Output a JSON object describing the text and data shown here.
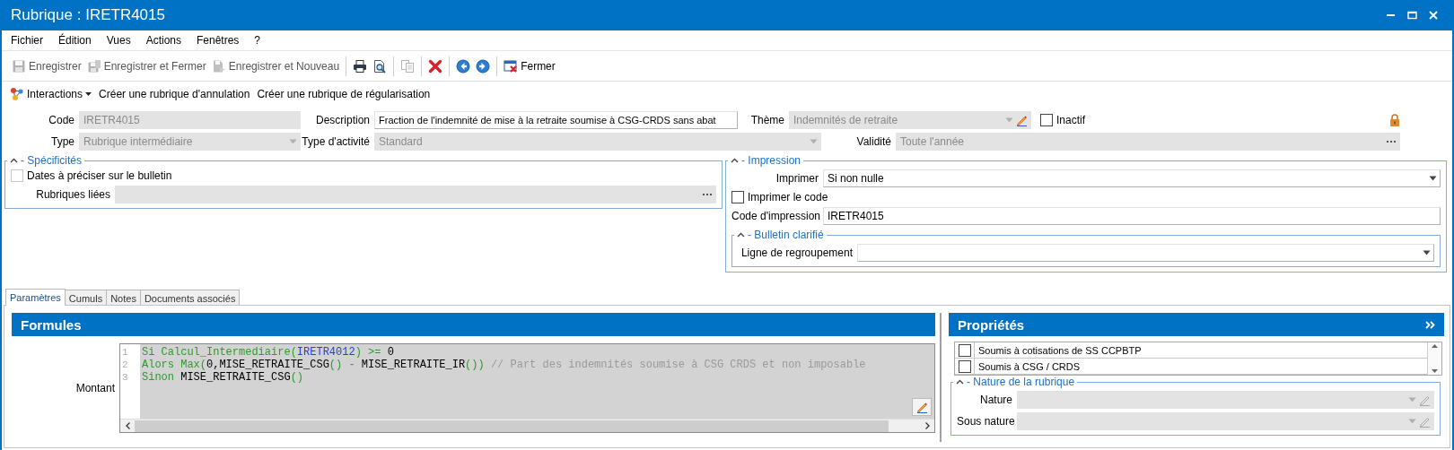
{
  "window": {
    "title": "Rubrique : IRETR4015"
  },
  "menu": [
    "Fichier",
    "Édition",
    "Vues",
    "Actions",
    "Fenêtres",
    "?"
  ],
  "toolbar": [
    {
      "kind": "text-button",
      "label": "Enregistrer",
      "disabled": true
    },
    {
      "kind": "text-button",
      "label": "Enregistrer et Fermer",
      "disabled": true
    },
    {
      "kind": "text-button",
      "label": "Enregistrer et Nouveau",
      "disabled": true
    },
    {
      "kind": "icon-button",
      "disabled": false
    },
    {
      "kind": "icon-button",
      "disabled": false
    },
    {
      "kind": "icon-button",
      "disabled": true
    },
    {
      "kind": "icon-button",
      "disabled": false
    },
    {
      "kind": "icon-button",
      "disabled": false
    },
    {
      "kind": "icon-button",
      "disabled": false
    },
    {
      "kind": "text-button",
      "label": "Fermer",
      "disabled": false
    }
  ],
  "actions": [
    {
      "kind": "menu-button",
      "label": "Interactions"
    },
    {
      "kind": "link-button",
      "label": "Créer une rubrique d'annulation"
    },
    {
      "kind": "link-button",
      "label": "Créer une rubrique de régularisation"
    }
  ],
  "form": {
    "locked": true,
    "rows": [
      [
        {
          "kind": "text",
          "label": "Code",
          "value": "IRETR4015",
          "disabled": true
        },
        {
          "kind": "text",
          "label": "Description",
          "value": "Fraction de l'indemnité de mise à la retraite soumise à CSG-CRDS sans abat",
          "disabled": false
        },
        {
          "kind": "dropdown",
          "label": "Thème",
          "value": "Indemnités de retraite",
          "disabled": true,
          "edit_button": {
            "disabled": false
          }
        },
        {
          "kind": "checkbox",
          "label": "Inactif",
          "checked": false,
          "disabled": false
        }
      ],
      [
        {
          "kind": "dropdown",
          "label": "Type",
          "value": "Rubrique intermédiaire",
          "disabled": true
        },
        {
          "kind": "dropdown",
          "label": "Type d'activité",
          "value": "Standard",
          "disabled": true
        },
        {
          "kind": "picker",
          "label": "Validité",
          "value": "Toute l'année",
          "disabled": true
        }
      ]
    ]
  },
  "groups": [
    {
      "title": "- Spécificités",
      "expanded": true,
      "items": [
        {
          "kind": "checkbox",
          "label": "Dates à préciser sur le bulletin",
          "checked": false,
          "disabled": true
        },
        {
          "kind": "picker",
          "label": "Rubriques liées",
          "disabled": true
        }
      ]
    },
    {
      "title": "- Impression",
      "expanded": true,
      "items": [
        {
          "kind": "dropdown",
          "label": "Imprimer",
          "value": "Si non nulle",
          "disabled": false
        },
        {
          "kind": "checkbox",
          "label": "Imprimer le code",
          "checked": false,
          "disabled": false
        },
        {
          "kind": "text",
          "label": "Code d'impression",
          "value": "IRETR4015",
          "disabled": false
        },
        {
          "kind": "group",
          "title": "- Bulletin clarifié",
          "expanded": true,
          "items": [
            {
              "kind": "dropdown",
              "label": "Ligne de regroupement",
              "disabled": false
            }
          ]
        }
      ]
    }
  ],
  "tabs": [
    {
      "label": "Paramètres",
      "selected": true
    },
    {
      "label": "Cumuls",
      "selected": false
    },
    {
      "label": "Notes",
      "selected": false
    },
    {
      "label": "Documents associés",
      "selected": false
    }
  ],
  "formulas": {
    "title": "Formules",
    "field_label": "Montant",
    "lines": [
      {
        "number": "1",
        "tokens": [
          {
            "kind": "keyword",
            "text": "Si Calcul_Intermediaire("
          },
          {
            "kind": "reference",
            "text": "IRETR4012"
          },
          {
            "kind": "keyword",
            "text": ") >= "
          },
          {
            "kind": "plain",
            "text": "0"
          }
        ]
      },
      {
        "number": "2",
        "tokens": [
          {
            "kind": "keyword",
            "text": "Alors Max("
          },
          {
            "kind": "plain",
            "text": "0,MISE_RETRAITE_CSG"
          },
          {
            "kind": "keyword",
            "text": "() - "
          },
          {
            "kind": "plain",
            "text": "MISE_RETRAITE_IR"
          },
          {
            "kind": "keyword",
            "text": "()) "
          },
          {
            "kind": "comment",
            "text": "// Part des indemnités soumise à CSG CRDS et non imposable"
          }
        ]
      },
      {
        "number": "3",
        "tokens": [
          {
            "kind": "keyword",
            "text": "Sinon "
          },
          {
            "kind": "plain",
            "text": "MISE_RETRAITE_CSG"
          },
          {
            "kind": "keyword",
            "text": "()"
          }
        ]
      }
    ]
  },
  "properties": {
    "title": "Propriétés",
    "items": [
      {
        "label": "Soumis à cotisations de SS CCPBTP",
        "checked": false
      },
      {
        "label": "Soumis à CSG / CRDS",
        "checked": false
      }
    ],
    "nature_group": {
      "title": "- Nature de la rubrique",
      "expanded": true,
      "items": [
        {
          "kind": "dropdown",
          "label": "Nature",
          "disabled": true,
          "edit_button": {
            "disabled": true
          }
        },
        {
          "kind": "dropdown",
          "label": "Sous nature",
          "disabled": true,
          "edit_button": {
            "disabled": true
          }
        }
      ]
    }
  }
}
